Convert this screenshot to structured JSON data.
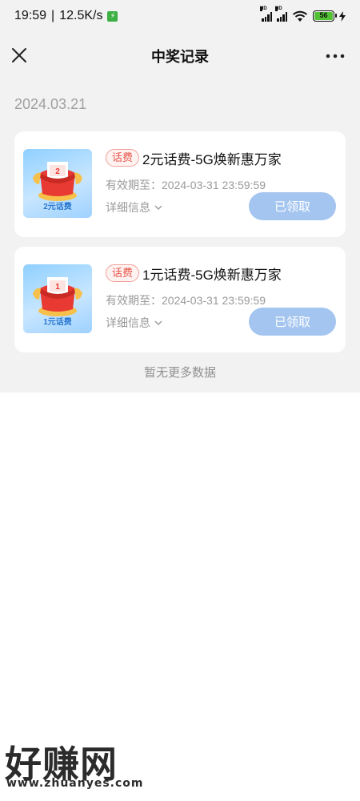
{
  "status": {
    "time": "19:59",
    "speed": "12.5K/s",
    "battery": "56"
  },
  "nav": {
    "title": "中奖记录"
  },
  "date_header": "2024.03.21",
  "records": [
    {
      "tag": "话费",
      "title": "2元话费-5G焕新惠万家",
      "validity": "有效期至：2024-03-31 23:59:59",
      "details": "详细信息",
      "button": "已领取",
      "thumb_caption": "2元话费",
      "thumb_amount": "2"
    },
    {
      "tag": "话费",
      "title": "1元话费-5G焕新惠万家",
      "validity": "有效期至：2024-03-31 23:59:59",
      "details": "详细信息",
      "button": "已领取",
      "thumb_caption": "1元话费",
      "thumb_amount": "1"
    }
  ],
  "footer_text": "暂无更多数据",
  "watermark": {
    "brand": "好赚网",
    "url": "www.zhuanyes.com"
  },
  "colors": {
    "accent_tag": "#e8534a",
    "claimed_button": "#a4c5ef",
    "page_bg": "#f2f2f2"
  }
}
